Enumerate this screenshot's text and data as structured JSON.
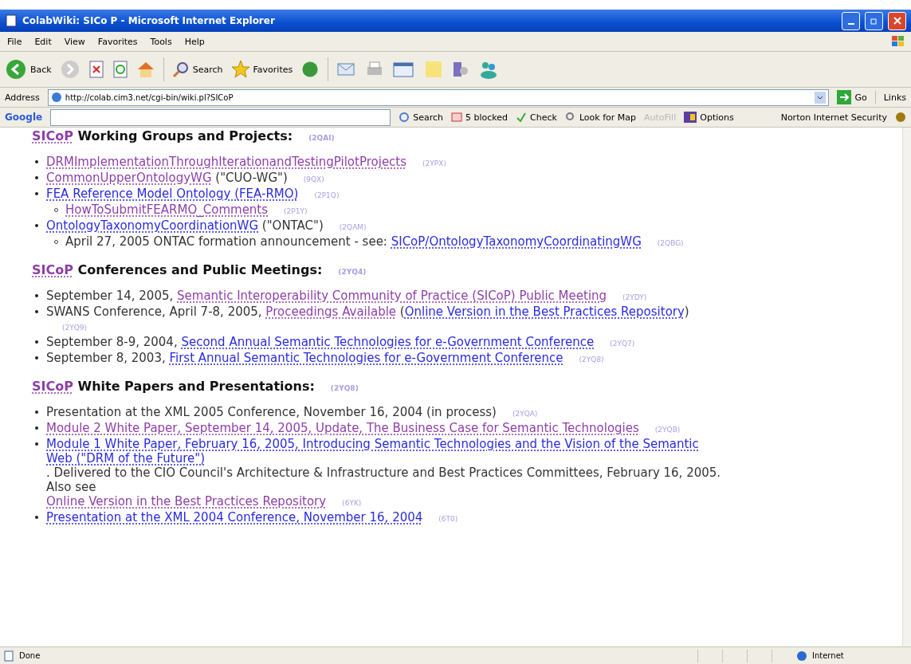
{
  "window": {
    "title": "ColabWiki: SICo P - Microsoft Internet Explorer"
  },
  "menu": [
    "File",
    "Edit",
    "View",
    "Favorites",
    "Tools",
    "Help"
  ],
  "toolbar": {
    "back": "Back",
    "search": "Search",
    "favorites": "Favorites"
  },
  "address": {
    "label": "Address",
    "url": "http://colab.cim3.net/cgi-bin/wiki.pl?SICoP",
    "go": "Go",
    "links": "Links"
  },
  "google_bar": {
    "logo": "Google",
    "search": "Search",
    "blocked": "5 blocked",
    "check": "Check",
    "map": "Look for Map",
    "autofill": {
      "label": "AutoFill",
      "disabled": true
    },
    "options": "Options",
    "norton": "Norton Internet Security"
  },
  "sections": [
    {
      "heading": [
        {
          "kind": "link",
          "text": "SICoP",
          "visited": true
        },
        {
          "kind": "text",
          "text": " Working Groups and Projects:"
        },
        {
          "kind": "tag",
          "text": "(2QAI)"
        }
      ],
      "items": [
        {
          "parts": [
            {
              "kind": "link",
              "text": "DRMImplementationThroughIterationandTestingPilotProjects",
              "visited": true
            },
            {
              "kind": "tag",
              "text": "(2YPX)"
            }
          ]
        },
        {
          "parts": [
            {
              "kind": "link",
              "text": "CommonUpperOntologyWG",
              "visited": true
            },
            {
              "kind": "text",
              "text": " (\"CUO-WG\")"
            },
            {
              "kind": "tag",
              "text": "(9QX)"
            }
          ]
        },
        {
          "parts": [
            {
              "kind": "link",
              "text": "FEA Reference Model Ontology (FEA-RMO)",
              "visited": false
            },
            {
              "kind": "tag",
              "text": "(2P1Q)"
            }
          ],
          "children": [
            {
              "parts": [
                {
                  "kind": "link",
                  "text": "HowToSubmitFEARMO_Comments",
                  "visited": true
                },
                {
                  "kind": "tag",
                  "text": "(2P1Y)"
                }
              ]
            }
          ]
        },
        {
          "parts": [
            {
              "kind": "link",
              "text": "OntologyTaxonomyCoordinationWG",
              "visited": false
            },
            {
              "kind": "text",
              "text": " (\"ONTAC\")"
            },
            {
              "kind": "tag",
              "text": "(2QAM)"
            }
          ],
          "children": [
            {
              "parts": [
                {
                  "kind": "text",
                  "text": "April 27, 2005 ONTAC formation announcement - see: "
                },
                {
                  "kind": "link",
                  "text": "SICoP/OntologyTaxonomyCoordinatingWG",
                  "visited": false
                },
                {
                  "kind": "tag",
                  "text": "(2QBG)"
                }
              ]
            }
          ]
        }
      ]
    },
    {
      "heading": [
        {
          "kind": "link",
          "text": "SICoP",
          "visited": true
        },
        {
          "kind": "text",
          "text": " Conferences and Public Meetings:"
        },
        {
          "kind": "tag",
          "text": "(2YQ4)"
        }
      ],
      "items": [
        {
          "parts": [
            {
              "kind": "text",
              "text": "September 14, 2005, "
            },
            {
              "kind": "link",
              "text": "Semantic Interoperability Community of Practice (SICoP) Public Meeting",
              "visited": true
            },
            {
              "kind": "tag",
              "text": "(2YDY)"
            }
          ]
        },
        {
          "parts": [
            {
              "kind": "text",
              "text": "SWANS Conference, April 7-8, 2005, "
            },
            {
              "kind": "link",
              "text": "Proceedings Available",
              "visited": true
            },
            {
              "kind": "text",
              "text": " ("
            },
            {
              "kind": "link",
              "text": "Online Version in the Best Practices Repository",
              "visited": false
            },
            {
              "kind": "text",
              "text": ")"
            },
            {
              "kind": "tag",
              "text": "(2YQ9)"
            }
          ]
        },
        {
          "parts": [
            {
              "kind": "text",
              "text": "September 8-9, 2004, "
            },
            {
              "kind": "link",
              "text": "Second Annual Semantic Technologies for e-Government Conference",
              "visited": false
            },
            {
              "kind": "tag",
              "text": "(2YQ7)"
            }
          ]
        },
        {
          "parts": [
            {
              "kind": "text",
              "text": "September 8, 2003, "
            },
            {
              "kind": "link",
              "text": "First Annual Semantic Technologies for e-Government Conference",
              "visited": false
            },
            {
              "kind": "tag",
              "text": "(2YQ8)"
            }
          ]
        }
      ]
    },
    {
      "heading": [
        {
          "kind": "link",
          "text": "SICoP",
          "visited": true
        },
        {
          "kind": "text",
          "text": " White Papers and Presentations:"
        },
        {
          "kind": "tag",
          "text": "(2YQ8)"
        }
      ],
      "items": [
        {
          "parts": [
            {
              "kind": "text",
              "text": "Presentation at the XML 2005 Conference, November 16, 2004 (in process)"
            },
            {
              "kind": "tag",
              "text": "(2YQA)"
            }
          ]
        },
        {
          "parts": [
            {
              "kind": "link",
              "text": "Module 2 White Paper, September 14, 2005, Update, The Business Case for Semantic Technologies",
              "visited": true
            },
            {
              "kind": "tag",
              "text": "(2YQB)"
            }
          ]
        },
        {
          "parts": [
            {
              "kind": "link",
              "text": "Module 1 White Paper, February 16, 2005, Introducing Semantic Technologies and the Vision of the Semantic Web (\"DRM of the Future\")",
              "visited": false
            },
            {
              "kind": "text",
              "text": ". Delivered to the CIO Council's Architecture & Infrastructure and Best Practices Committees, February 16, 2005. Also see "
            },
            {
              "kind": "link",
              "text": "Online Version in the Best Practices Repository",
              "visited": true
            },
            {
              "kind": "tag",
              "text": "(6YK)"
            }
          ]
        },
        {
          "parts": [
            {
              "kind": "link",
              "text": "Presentation at the XML 2004 Conference, November 16, 2004",
              "visited": false
            },
            {
              "kind": "tag",
              "text": "(6T0)"
            }
          ]
        }
      ]
    }
  ],
  "status": {
    "text": "Done",
    "zone": "Internet"
  }
}
